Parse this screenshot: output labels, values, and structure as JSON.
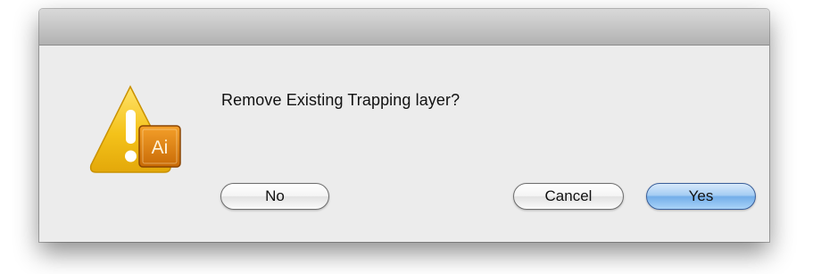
{
  "dialog": {
    "message": "Remove Existing Trapping layer?",
    "icon": {
      "type": "warning-triangle",
      "badge_text": "Ai",
      "warning_color": "#f4c21a",
      "badge_color": "#e98a12"
    },
    "buttons": {
      "no": "No",
      "cancel": "Cancel",
      "yes": "Yes"
    },
    "default_button": "yes",
    "accent_color": "#73aee9"
  }
}
